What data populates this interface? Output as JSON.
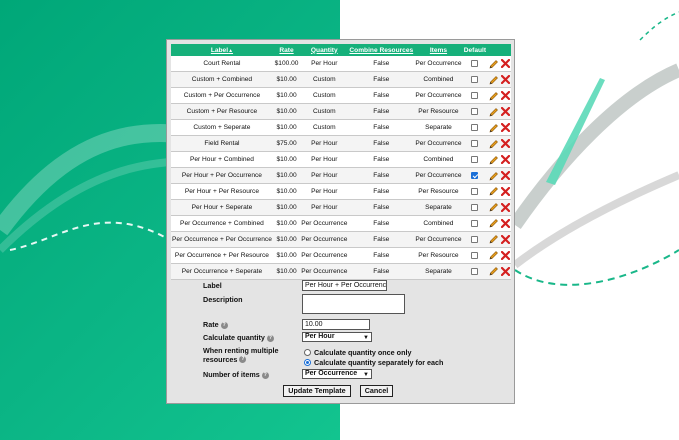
{
  "colors": {
    "brand_green": "#16b07a",
    "background_green": "#0bb585",
    "edit_orange": "#e8a020",
    "delete_red": "#d42020",
    "checked_blue": "#1a6fd8"
  },
  "table": {
    "headers": {
      "label": "Label",
      "sort_indicator": "▲",
      "rate": "Rate",
      "quantity": "Quantity",
      "combine_resources": "Combine Resources",
      "items": "Items",
      "default": "Default"
    },
    "rows": [
      {
        "label": "Court Rental",
        "rate": "$100.00",
        "quantity": "Per Hour",
        "combine": "False",
        "items": "Per Occurrence",
        "default": false
      },
      {
        "label": "Custom + Combined",
        "rate": "$10.00",
        "quantity": "Custom",
        "combine": "False",
        "items": "Combined",
        "default": false
      },
      {
        "label": "Custom + Per Occurrence",
        "rate": "$10.00",
        "quantity": "Custom",
        "combine": "False",
        "items": "Per Occurrence",
        "default": false
      },
      {
        "label": "Custom + Per Resource",
        "rate": "$10.00",
        "quantity": "Custom",
        "combine": "False",
        "items": "Per Resource",
        "default": false
      },
      {
        "label": "Custom + Seperate",
        "rate": "$10.00",
        "quantity": "Custom",
        "combine": "False",
        "items": "Separate",
        "default": false
      },
      {
        "label": "Field Rental",
        "rate": "$75.00",
        "quantity": "Per Hour",
        "combine": "False",
        "items": "Per Occurrence",
        "default": false
      },
      {
        "label": "Per Hour + Combined",
        "rate": "$10.00",
        "quantity": "Per Hour",
        "combine": "False",
        "items": "Combined",
        "default": false
      },
      {
        "label": "Per Hour + Per Occurrence",
        "rate": "$10.00",
        "quantity": "Per Hour",
        "combine": "False",
        "items": "Per Occurrence",
        "default": true
      },
      {
        "label": "Per Hour + Per Resource",
        "rate": "$10.00",
        "quantity": "Per Hour",
        "combine": "False",
        "items": "Per Resource",
        "default": false
      },
      {
        "label": "Per Hour + Seperate",
        "rate": "$10.00",
        "quantity": "Per Hour",
        "combine": "False",
        "items": "Separate",
        "default": false
      },
      {
        "label": "Per Occurrence + Combined",
        "rate": "$10.00",
        "quantity": "Per Occurrence",
        "combine": "False",
        "items": "Combined",
        "default": false
      },
      {
        "label": "Per Occurrence + Per Occurrence",
        "rate": "$10.00",
        "quantity": "Per Occurrence",
        "combine": "False",
        "items": "Per Occurrence",
        "default": false
      },
      {
        "label": "Per Occurrence + Per Resource",
        "rate": "$10.00",
        "quantity": "Per Occurrence",
        "combine": "False",
        "items": "Per Resource",
        "default": false
      },
      {
        "label": "Per Occurrence + Seperate",
        "rate": "$10.00",
        "quantity": "Per Occurrence",
        "combine": "False",
        "items": "Separate",
        "default": false
      }
    ]
  },
  "form": {
    "label_label": "Label",
    "label_value": "Per Hour + Per Occurrence",
    "description_label": "Description",
    "description_value": "",
    "rate_label": "Rate",
    "rate_value": "10.00",
    "calc_qty_label": "Calculate quantity",
    "calc_qty_value": "Per Hour",
    "multi_label_line1": "When renting multiple",
    "multi_label_line2": "resources",
    "multi_option_once": "Calculate quantity once only",
    "multi_option_each": "Calculate quantity separately for each",
    "multi_selected": "each",
    "num_items_label": "Number of items",
    "num_items_value": "Per Occurrence",
    "update_button": "Update Template",
    "cancel_button": "Cancel"
  }
}
